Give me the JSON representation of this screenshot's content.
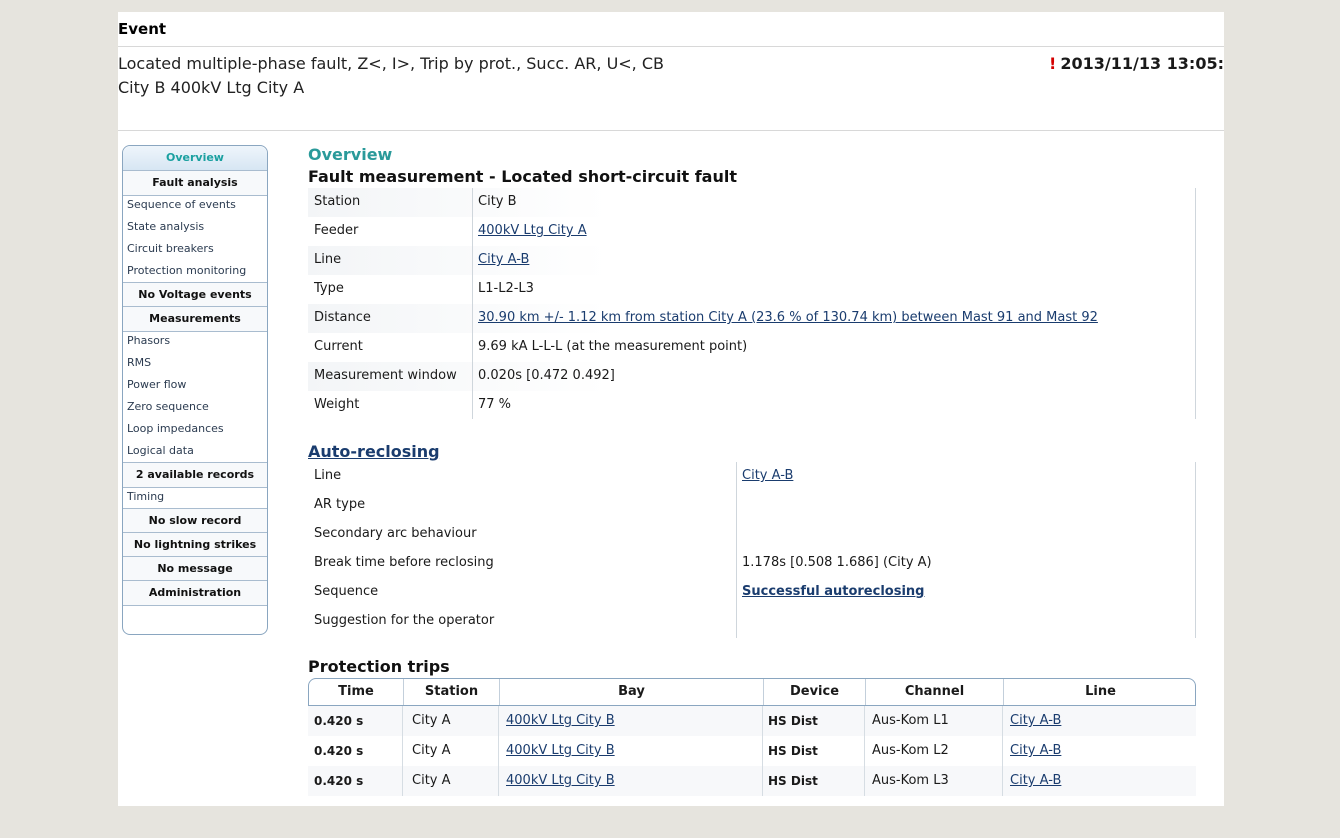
{
  "header": {
    "label": "Event",
    "title_line1": "Located multiple-phase fault, Z<, I>, Trip by prot., Succ. AR, U<, CB",
    "title_line2": "City B 400kV Ltg City A",
    "alert_icon": "!",
    "timestamp": "2013/11/13 13:05:"
  },
  "sidebar": {
    "active": "Overview",
    "items": [
      {
        "label": "Fault analysis",
        "kind": "head"
      },
      {
        "label": "Sequence of events",
        "kind": "link"
      },
      {
        "label": "State analysis",
        "kind": "link"
      },
      {
        "label": "Circuit breakers",
        "kind": "link"
      },
      {
        "label": "Protection monitoring",
        "kind": "link"
      },
      {
        "label": "No Voltage events",
        "kind": "head"
      },
      {
        "label": "Measurements",
        "kind": "head"
      },
      {
        "label": "Phasors",
        "kind": "link"
      },
      {
        "label": "RMS",
        "kind": "link"
      },
      {
        "label": "Power flow",
        "kind": "link"
      },
      {
        "label": "Zero sequence",
        "kind": "link"
      },
      {
        "label": "Loop impedances",
        "kind": "link"
      },
      {
        "label": "Logical data",
        "kind": "link"
      },
      {
        "label": "2 available records",
        "kind": "head"
      },
      {
        "label": "Timing",
        "kind": "link"
      },
      {
        "label": "No slow record",
        "kind": "head"
      },
      {
        "label": "No lightning strikes",
        "kind": "head"
      },
      {
        "label": "No message",
        "kind": "head"
      },
      {
        "label": "Administration",
        "kind": "head"
      }
    ]
  },
  "overview": {
    "heading": "Overview",
    "fault_title": "Fault measurement - Located short-circuit fault",
    "rows": [
      {
        "key": "Station",
        "value": "City B",
        "link": false
      },
      {
        "key": "Feeder",
        "value": "400kV Ltg City A",
        "link": true
      },
      {
        "key": "Line",
        "value": "City A-B",
        "link": true
      },
      {
        "key": "Type",
        "value": "L1-L2-L3",
        "link": false
      },
      {
        "key": "Distance",
        "value": "30.90 km +/- 1.12 km from station City A (23.6 % of 130.74 km) between Mast 91 and Mast 92",
        "link": true
      },
      {
        "key": "Current",
        "value": "9.69 kA L-L-L (at the measurement point)",
        "link": false
      },
      {
        "key": "Measurement window",
        "value": "0.020s [0.472 0.492]",
        "link": false
      },
      {
        "key": "Weight",
        "value": "77 %",
        "link": false
      }
    ]
  },
  "autoreclosing": {
    "title": "Auto-reclosing",
    "rows": [
      {
        "key": "Line",
        "value": "City A-B",
        "link": true,
        "bold": false
      },
      {
        "key": "AR type",
        "value": "",
        "link": false,
        "bold": false
      },
      {
        "key": "Secondary arc behaviour",
        "value": "",
        "link": false,
        "bold": false
      },
      {
        "key": "Break time before reclosing",
        "value": "1.178s [0.508 1.686] (City A)",
        "link": false,
        "bold": false
      },
      {
        "key": "Sequence",
        "value": "Successful autoreclosing",
        "link": true,
        "bold": true
      },
      {
        "key": "Suggestion for the operator",
        "value": "",
        "link": false,
        "bold": false
      }
    ]
  },
  "trips": {
    "title": "Protection trips",
    "columns": [
      "Time",
      "Station",
      "Bay",
      "Device",
      "Channel",
      "Line"
    ],
    "rows": [
      [
        "0.420 s",
        "City A",
        "400kV Ltg City B",
        "HS Dist",
        "Aus-Kom L1",
        "City A-B"
      ],
      [
        "0.420 s",
        "City A",
        "400kV Ltg City B",
        "HS Dist",
        "Aus-Kom L2",
        "City A-B"
      ],
      [
        "0.420 s",
        "City A",
        "400kV Ltg City B",
        "HS Dist",
        "Aus-Kom L3",
        "City A-B"
      ]
    ]
  }
}
